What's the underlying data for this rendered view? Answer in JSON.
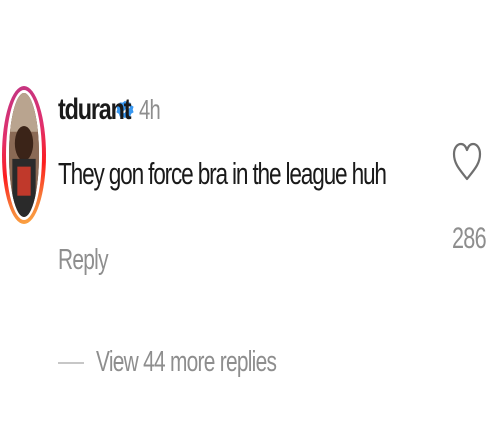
{
  "comment": {
    "username": "tdurant",
    "verified": true,
    "time": "4h",
    "text": "They gon force bra in the league huh",
    "reply_label": "Reply",
    "like_icon": "heart-outline-icon",
    "like_count": "286",
    "view_replies_label": "View 44 more replies"
  },
  "colors": {
    "primary_text": "#1a1a1a",
    "secondary_text": "#8e8e8e",
    "verified_blue": "#3897f0",
    "background": "#ffffff"
  }
}
